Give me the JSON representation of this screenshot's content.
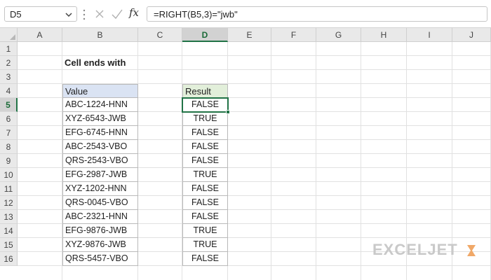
{
  "formula_bar": {
    "name_box": "D5",
    "fx_label": "fx",
    "formula": "=RIGHT(B5,3)=\"jwb\""
  },
  "grid": {
    "columns": [
      "A",
      "B",
      "C",
      "D",
      "E",
      "F",
      "G",
      "H",
      "I",
      "J"
    ],
    "rows": [
      "1",
      "2",
      "3",
      "4",
      "5",
      "6",
      "7",
      "8",
      "9",
      "10",
      "11",
      "12",
      "13",
      "14",
      "15",
      "16"
    ],
    "selected_column": "D",
    "selected_row": "5"
  },
  "sheet": {
    "title": "Cell ends with",
    "value_header": "Value",
    "result_header": "Result",
    "values": [
      "ABC-1224-HNN",
      "XYZ-6543-JWB",
      "EFG-6745-HNN",
      "ABC-2543-VBO",
      "QRS-2543-VBO",
      "EFG-2987-JWB",
      "XYZ-1202-HNN",
      "QRS-0045-VBO",
      "ABC-2321-HNN",
      "EFG-9876-JWB",
      "XYZ-9876-JWB",
      "QRS-5457-VBO"
    ],
    "results": [
      "FALSE",
      "TRUE",
      "FALSE",
      "FALSE",
      "FALSE",
      "TRUE",
      "FALSE",
      "FALSE",
      "FALSE",
      "TRUE",
      "TRUE",
      "FALSE"
    ]
  },
  "branding": {
    "logo_text": "EXCELJET"
  },
  "colors": {
    "value_header_bg": "#dae3f3",
    "result_header_bg": "#e2efda",
    "selection_accent": "#217346",
    "logo_gray": "#c9c9c9",
    "logo_mark_orange": "#f0a868"
  }
}
